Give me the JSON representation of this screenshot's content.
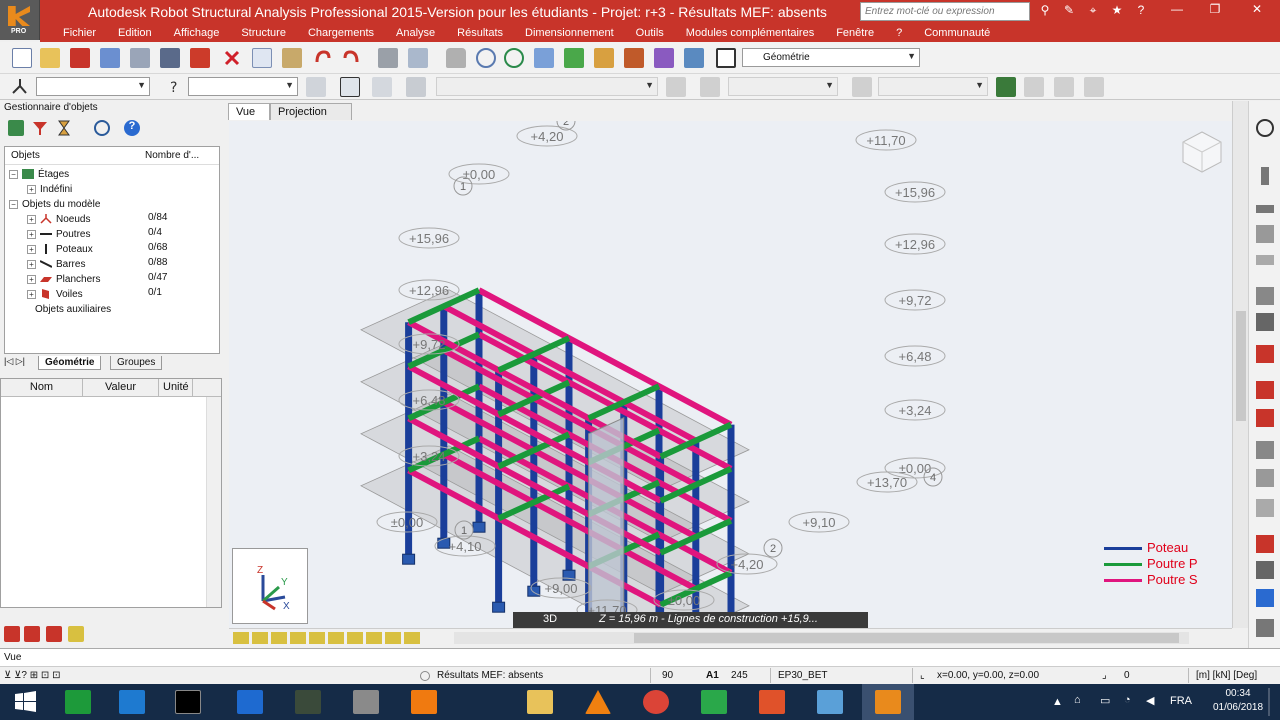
{
  "window": {
    "title": "Autodesk Robot Structural Analysis Professional 2015-Version pour les étudiants - Projet: r+3 - Résultats MEF: absents",
    "logo_text": "PRO",
    "search_placeholder": "Entrez mot-clé ou expression"
  },
  "menu": [
    "Fichier",
    "Edition",
    "Affichage",
    "Structure",
    "Chargements",
    "Analyse",
    "Résultats",
    "Dimensionnement",
    "Outils",
    "Modules complémentaires",
    "Fenêtre",
    "?",
    "Communauté"
  ],
  "toolbar": {
    "layout_combo": "Géométrie"
  },
  "object_manager": {
    "title": "Gestionnaire d'objets",
    "columns": [
      "Objets",
      "Nombre d'..."
    ],
    "tree": [
      {
        "label": "Étages",
        "count": ""
      },
      {
        "label": "Indéfini",
        "count": ""
      },
      {
        "label": "Objets du modèle",
        "count": ""
      },
      {
        "label": "Noeuds",
        "count": "0/84"
      },
      {
        "label": "Poutres",
        "count": "0/4"
      },
      {
        "label": "Poteaux",
        "count": "0/68"
      },
      {
        "label": "Barres",
        "count": "0/88"
      },
      {
        "label": "Planchers",
        "count": "0/47"
      },
      {
        "label": "Voiles",
        "count": "0/1"
      },
      {
        "label": "Objets auxiliaires",
        "count": ""
      }
    ],
    "tabs": [
      "Géométrie",
      "Groupes"
    ],
    "prop_columns": [
      "Nom",
      "Valeur",
      "Unité"
    ]
  },
  "view": {
    "tabs": [
      "Vue",
      "Projection"
    ],
    "mode": "3D",
    "status": "Z = 15,96 m - Lignes de construction +15,9...",
    "legend": [
      {
        "label": "Poteau",
        "color": "#1a3e9a"
      },
      {
        "label": "Poutre P",
        "color": "#1a9a3a"
      },
      {
        "label": "Poutre S",
        "color": "#e0157e"
      }
    ],
    "level_labels_left": [
      "+4,20",
      "±0,00",
      "+15,96",
      "+12,96",
      "+9,72",
      "+6,48",
      "+3,24",
      "±0,00",
      "+4,10",
      "+9,00",
      "+11,70"
    ],
    "level_labels_right": [
      "+11,70",
      "+15,96",
      "+12,96",
      "+9,72",
      "+6,48",
      "+3,24",
      "±0,00",
      "+13,70",
      "+9,10",
      "+4,20",
      "±0,00"
    ],
    "grid_markers": [
      "1",
      "2",
      "1",
      "2",
      "4"
    ]
  },
  "command_line": "Vue",
  "statusbar": {
    "results": "Résultats MEF: absents",
    "n1": "90",
    "n2": "245",
    "section": "EP30_BET",
    "coords": "x=0.00, y=0.00, z=0.00",
    "angle": "0",
    "units": "[m] [kN] [Deg]"
  },
  "taskbar": {
    "lang": "FRA",
    "time": "00:34",
    "date": "01/06/2018"
  }
}
